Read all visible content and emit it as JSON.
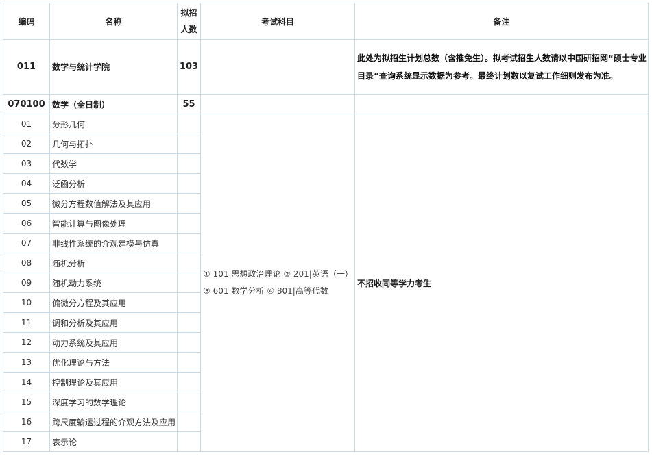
{
  "header": {
    "code": "编码",
    "name": "名称",
    "quota": "拟招人数",
    "subjects": "考试科目",
    "remarks": "备注"
  },
  "college": {
    "code": "011",
    "name": "数学与统计学院",
    "quota": "103",
    "subjects": "",
    "remarks": "此处为拟招生计划总数（含推免生）。拟考试招生人数请以中国研招网“硕士专业目录”查询系统显示数据为参考。最终计划数以复试工作细则发布为准。"
  },
  "major": {
    "code": "070100",
    "name": "数学（全日制）",
    "quota": "55",
    "subjects": "",
    "remarks": ""
  },
  "directions": [
    {
      "code": "01",
      "name": "分形几何"
    },
    {
      "code": "02",
      "name": "几何与拓扑"
    },
    {
      "code": "03",
      "name": "代数学"
    },
    {
      "code": "04",
      "name": "泛函分析"
    },
    {
      "code": "05",
      "name": "微分方程数值解法及其应用"
    },
    {
      "code": "06",
      "name": "智能计算与图像处理"
    },
    {
      "code": "07",
      "name": "非线性系统的介观建模与仿真"
    },
    {
      "code": "08",
      "name": "随机分析"
    },
    {
      "code": "09",
      "name": "随机动力系统"
    },
    {
      "code": "10",
      "name": "偏微分方程及其应用"
    },
    {
      "code": "11",
      "name": "调和分析及其应用"
    },
    {
      "code": "12",
      "name": "动力系统及其应用"
    },
    {
      "code": "13",
      "name": "优化理论与方法"
    },
    {
      "code": "14",
      "name": "控制理论及其应用"
    },
    {
      "code": "15",
      "name": "深度学习的数学理论"
    },
    {
      "code": "16",
      "name": "跨尺度输运过程的介观方法及应用"
    },
    {
      "code": "17",
      "name": "表示论"
    }
  ],
  "directions_subjects": "① 101|思想政治理论 ② 201|英语（一） ③ 601|数学分析 ④ 801|高等代数",
  "directions_remarks": "不招收同等学力考生"
}
